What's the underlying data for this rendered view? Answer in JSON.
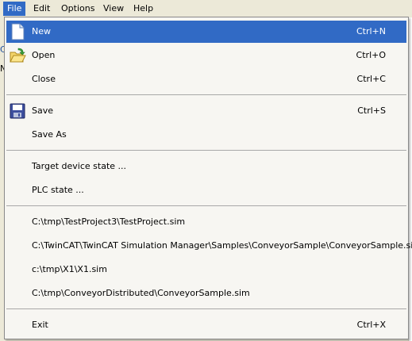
{
  "menubar": {
    "items": [
      {
        "label": "File",
        "active": true
      },
      {
        "label": "Edit"
      },
      {
        "label": "Options"
      },
      {
        "label": "View"
      },
      {
        "label": "Help"
      }
    ]
  },
  "background": {
    "frag1": "C",
    "frag2": "N"
  },
  "file_menu": {
    "new": {
      "label": "New",
      "shortcut": "Ctrl+N",
      "icon": "new-document-icon"
    },
    "open": {
      "label": "Open",
      "shortcut": "Ctrl+O",
      "icon": "open-folder-icon"
    },
    "close": {
      "label": "Close",
      "shortcut": "Ctrl+C"
    },
    "save": {
      "label": "Save",
      "shortcut": "Ctrl+S",
      "icon": "floppy-disk-icon"
    },
    "save_as": {
      "label": "Save As"
    },
    "target_device_state": {
      "label": "Target device state ..."
    },
    "plc_state": {
      "label": "PLC state ..."
    },
    "recent": [
      "C:\\tmp\\TestProject3\\TestProject.sim",
      "C:\\TwinCAT\\TwinCAT Simulation Manager\\Samples\\ConveyorSample\\ConveyorSample.sim",
      "c:\\tmp\\X1\\X1.sim",
      "C:\\tmp\\ConveyorDistributed\\ConveyorSample.sim"
    ],
    "exit": {
      "label": "Exit",
      "shortcut": "Ctrl+X"
    }
  },
  "colors": {
    "highlight": "#316ac5",
    "menu_bg": "#f7f6f2",
    "menubar_bg": "#ece9d8"
  }
}
